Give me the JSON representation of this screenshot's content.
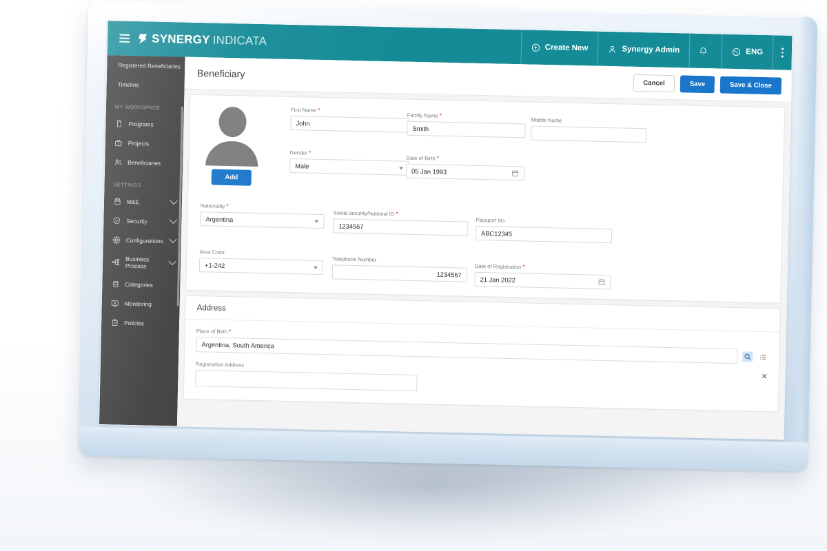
{
  "appbar": {
    "menu_icon": "hamburger-icon",
    "brand_primary": "SYNERGY",
    "brand_secondary": "INDICATA",
    "items": [
      {
        "label": "Create New",
        "icon": "plus-circle-icon"
      },
      {
        "label": "Synergy Admin",
        "icon": "user-icon"
      },
      {
        "label": "",
        "icon": "bell-icon"
      },
      {
        "label": "ENG",
        "icon": "globe-icon"
      },
      {
        "label": "",
        "icon": "more-vertical-icon"
      }
    ]
  },
  "sidebar": {
    "top_items": [
      {
        "label": "Registered Beneficiaries"
      },
      {
        "label": "Timeline"
      }
    ],
    "sections": [
      {
        "title": "MY WORKSPACE",
        "items": [
          {
            "label": "Programs",
            "icon": "document-icon",
            "expandable": false
          },
          {
            "label": "Projects",
            "icon": "briefcase-icon",
            "expandable": false
          },
          {
            "label": "Beneficiaries",
            "icon": "people-icon",
            "expandable": false
          }
        ]
      },
      {
        "title": "SETTINGS",
        "items": [
          {
            "label": "M&E",
            "icon": "box-icon",
            "expandable": true
          },
          {
            "label": "Security",
            "icon": "shield-check-icon",
            "expandable": true
          },
          {
            "label": "Configurations",
            "icon": "gear-icon",
            "expandable": true
          },
          {
            "label": "Business Process",
            "icon": "workflow-icon",
            "expandable": true
          },
          {
            "label": "Categories",
            "icon": "database-icon",
            "expandable": false
          },
          {
            "label": "Monitoring",
            "icon": "monitor-plus-icon",
            "expandable": false
          },
          {
            "label": "Policies",
            "icon": "clipboard-check-icon",
            "expandable": false
          }
        ]
      }
    ]
  },
  "page": {
    "title": "Beneficiary",
    "actions": {
      "cancel": "Cancel",
      "save": "Save",
      "save_close": "Save & Close"
    }
  },
  "photo": {
    "add_label": "Add",
    "avatar_icon": "user-placeholder-icon"
  },
  "form": {
    "first_name": {
      "label": "First Name",
      "value": "John",
      "required": true
    },
    "family_name": {
      "label": "Family Name",
      "value": "Smith",
      "required": true
    },
    "middle_name": {
      "label": "Middle Name",
      "value": "",
      "required": false
    },
    "gender": {
      "label": "Gender",
      "value": "Male",
      "required": true
    },
    "date_of_birth": {
      "label": "Date of Birth",
      "value": "05 Jan 1993",
      "required": true,
      "icon": "calendar-icon"
    },
    "nationality": {
      "label": "Nationality",
      "value": "Argentina",
      "required": true
    },
    "national_id": {
      "label": "Social security/National ID",
      "value": "1234567",
      "required": true
    },
    "passport_no": {
      "label": "Passport No",
      "value": "ABC12345",
      "required": false
    },
    "area_code": {
      "label": "Area Code",
      "value": "+1-242",
      "required": false
    },
    "telephone": {
      "label": "Telephone Number",
      "value": "1234567",
      "required": false
    },
    "date_of_registration": {
      "label": "Date of Registration",
      "value": "21 Jan 2022",
      "required": true,
      "icon": "calendar-icon"
    }
  },
  "address": {
    "section_title": "Address",
    "place_of_birth": {
      "label": "Place of Birth",
      "value": "Argentina, South America",
      "required": true,
      "search_icon": "search-icon",
      "list_icon": "list-icon"
    },
    "registration_address": {
      "label": "Registration Address",
      "value": "",
      "required": false,
      "clear_icon": "close-icon"
    }
  },
  "colors": {
    "appbar_teal": "#148b97",
    "primary_blue": "#1a76ca",
    "sidebar_dark": "#3d3d3d",
    "required_red": "#e23b2e",
    "bezel_blue": "#cfdfee"
  }
}
